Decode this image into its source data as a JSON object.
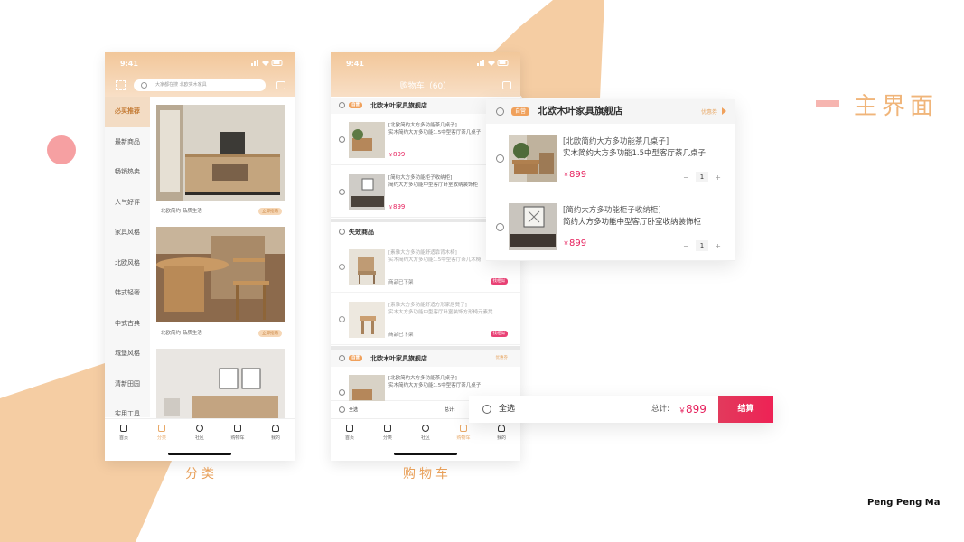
{
  "colors": {
    "peach": "#f5cda3",
    "accent": "#e8a05a",
    "price": "#e6215d",
    "pink_dot": "#f6a0a2"
  },
  "status_time": "9:41",
  "heading": "主界面",
  "credit": "Peng Peng Ma",
  "captions": {
    "category": "分类",
    "cart": "购物车"
  },
  "category": {
    "search_placeholder": "大家都在搜 北欧实木家具",
    "sidebar": [
      "必买推荐",
      "最新商品",
      "畅销热卖",
      "人气好评",
      "家具风格",
      "北欧风格",
      "韩式轻奢",
      "中式古典",
      "城堡风格",
      "清新田园",
      "实用工具"
    ],
    "cards": [
      {
        "caption": "北欧简约 品质生活",
        "button": "立即抢购"
      },
      {
        "caption": "北欧简约 品质生活",
        "button": "立即抢购"
      }
    ]
  },
  "tabbar": [
    "首页",
    "分类",
    "社区",
    "购物车",
    "我的"
  ],
  "cart": {
    "title": "购物车（60）",
    "store_tag": "自营",
    "store_name": "北欧木叶家具旗舰店",
    "coupon": "优惠券",
    "items": [
      {
        "line1": "[北欧简约大方多功能茶几桌子]",
        "line2": "实木简约大方多功能1.5中型客厅茶几桌子",
        "price": "899",
        "qty": "1"
      },
      {
        "line1": "[简约大方多功能柜子收纳柜]",
        "line2": "简约大方多功能中型客厅卧室收纳装饰柜",
        "price": "899",
        "qty": "1"
      }
    ],
    "invalid_title": "失效商品",
    "invalid_clear": "清空失效",
    "invalid_items": [
      {
        "line1": "[素雅大方多功能舒适靠背木椅]",
        "line2": "实木简约大方多功能1.5中型客厅茶几木椅",
        "status": "商品已下架",
        "badge": "找相似"
      },
      {
        "line1": "[素雅大方多功能舒适方形家居凳子]",
        "line2": "实木大方多功能中型客厅卧室装饰方形椅元素凳",
        "status": "商品已下架",
        "badge": "找相似"
      }
    ],
    "store2_items": [
      {
        "line1": "[北欧简约大方多功能茶几桌子]",
        "line2": "实木简约大方多功能1.5中型客厅茶几桌子"
      }
    ],
    "select_all": "全选",
    "total_label": "总计:",
    "total_amount": "899",
    "currency": "￥",
    "checkout": "结算"
  }
}
